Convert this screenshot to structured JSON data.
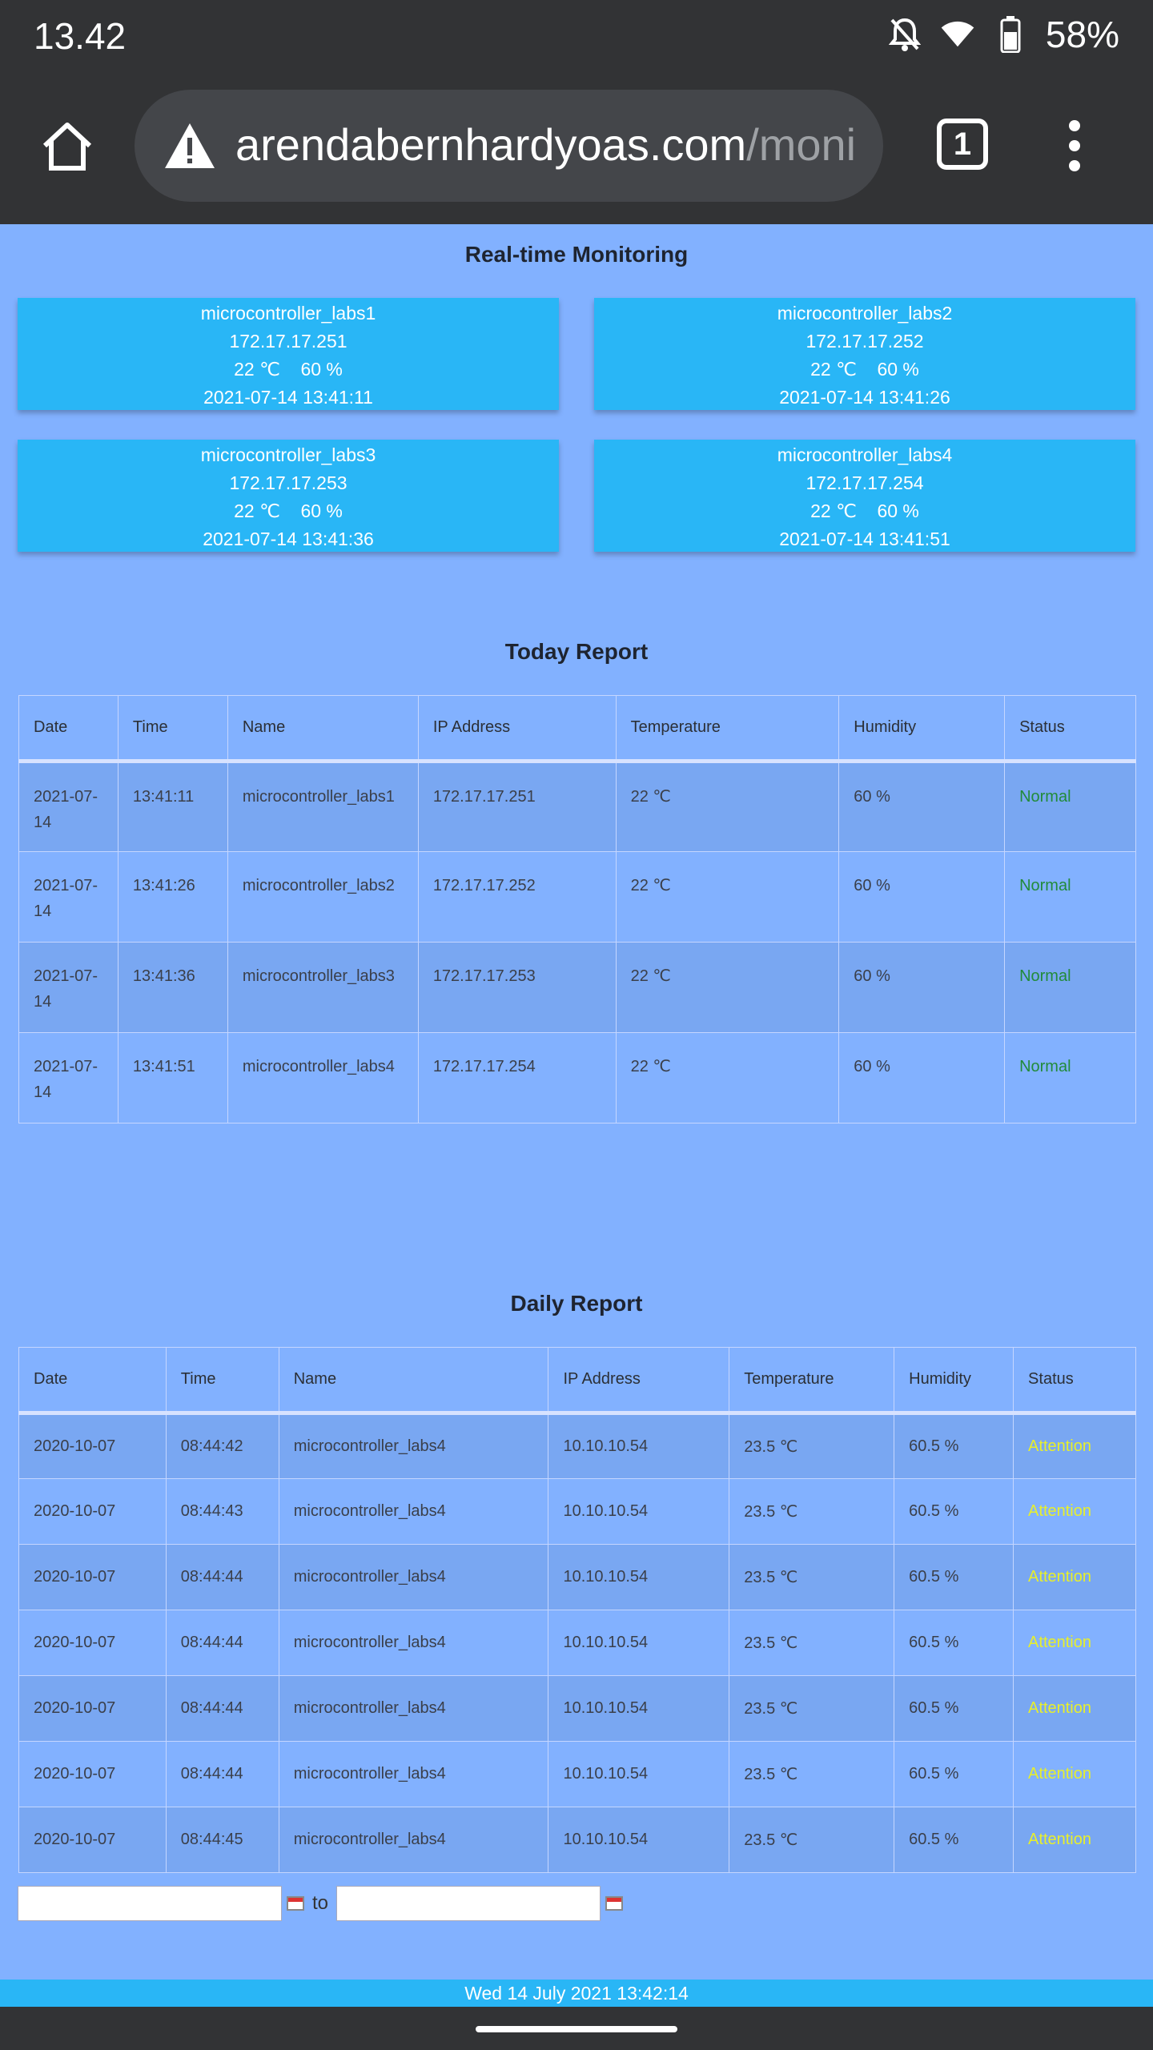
{
  "status_bar": {
    "time": "13.42",
    "battery": "58%"
  },
  "browser": {
    "url_host": "arendabernhardyoas.com",
    "url_path": "/moni",
    "tab_count": "1"
  },
  "realtime": {
    "title": "Real-time Monitoring",
    "cards": [
      {
        "name": "microcontroller_labs1",
        "ip": "172.17.17.251",
        "reading": "22 ℃    60 %",
        "timestamp": "2021-07-14 13:41:11"
      },
      {
        "name": "microcontroller_labs2",
        "ip": "172.17.17.252",
        "reading": "22 ℃    60 %",
        "timestamp": "2021-07-14 13:41:26"
      },
      {
        "name": "microcontroller_labs3",
        "ip": "172.17.17.253",
        "reading": "22 ℃    60 %",
        "timestamp": "2021-07-14 13:41:36"
      },
      {
        "name": "microcontroller_labs4",
        "ip": "172.17.17.254",
        "reading": "22 ℃    60 %",
        "timestamp": "2021-07-14 13:41:51"
      }
    ]
  },
  "today": {
    "title": "Today Report",
    "headers": [
      "Date",
      "Time",
      "Name",
      "IP Address",
      "Temperature",
      "Humidity",
      "Status"
    ],
    "rows": [
      {
        "date": "2021-07-14",
        "time": "13:41:11",
        "name": "microcontroller_labs1",
        "ip": "172.17.17.251",
        "temp": "22 ℃",
        "humidity": "60 %",
        "status": "Normal"
      },
      {
        "date": "2021-07-14",
        "time": "13:41:26",
        "name": "microcontroller_labs2",
        "ip": "172.17.17.252",
        "temp": "22 ℃",
        "humidity": "60 %",
        "status": "Normal"
      },
      {
        "date": "2021-07-14",
        "time": "13:41:36",
        "name": "microcontroller_labs3",
        "ip": "172.17.17.253",
        "temp": "22 ℃",
        "humidity": "60 %",
        "status": "Normal"
      },
      {
        "date": "2021-07-14",
        "time": "13:41:51",
        "name": "microcontroller_labs4",
        "ip": "172.17.17.254",
        "temp": "22 ℃",
        "humidity": "60 %",
        "status": "Normal"
      }
    ]
  },
  "daily": {
    "title": "Daily Report",
    "headers": [
      "Date",
      "Time",
      "Name",
      "IP Address",
      "Temperature",
      "Humidity",
      "Status"
    ],
    "rows": [
      {
        "date": "2020-10-07",
        "time": "08:44:42",
        "name": "microcontroller_labs4",
        "ip": "10.10.10.54",
        "temp": "23.5 ℃",
        "humidity": "60.5 %",
        "status": "Attention"
      },
      {
        "date": "2020-10-07",
        "time": "08:44:43",
        "name": "microcontroller_labs4",
        "ip": "10.10.10.54",
        "temp": "23.5 ℃",
        "humidity": "60.5 %",
        "status": "Attention"
      },
      {
        "date": "2020-10-07",
        "time": "08:44:44",
        "name": "microcontroller_labs4",
        "ip": "10.10.10.54",
        "temp": "23.5 ℃",
        "humidity": "60.5 %",
        "status": "Attention"
      },
      {
        "date": "2020-10-07",
        "time": "08:44:44",
        "name": "microcontroller_labs4",
        "ip": "10.10.10.54",
        "temp": "23.5 ℃",
        "humidity": "60.5 %",
        "status": "Attention"
      },
      {
        "date": "2020-10-07",
        "time": "08:44:44",
        "name": "microcontroller_labs4",
        "ip": "10.10.10.54",
        "temp": "23.5 ℃",
        "humidity": "60.5 %",
        "status": "Attention"
      },
      {
        "date": "2020-10-07",
        "time": "08:44:44",
        "name": "microcontroller_labs4",
        "ip": "10.10.10.54",
        "temp": "23.5 ℃",
        "humidity": "60.5 %",
        "status": "Attention"
      },
      {
        "date": "2020-10-07",
        "time": "08:44:45",
        "name": "microcontroller_labs4",
        "ip": "10.10.10.54",
        "temp": "23.5 ℃",
        "humidity": "60.5 %",
        "status": "Attention"
      }
    ]
  },
  "date_filter": {
    "to_label": "to"
  },
  "footer": {
    "datetime": "Wed 14 July 2021 13:42:14"
  },
  "colors": {
    "page_bg": "#82b1ff",
    "card_bg": "#29b6f6",
    "normal": "#228b3a",
    "attention": "#e8ef2a"
  }
}
